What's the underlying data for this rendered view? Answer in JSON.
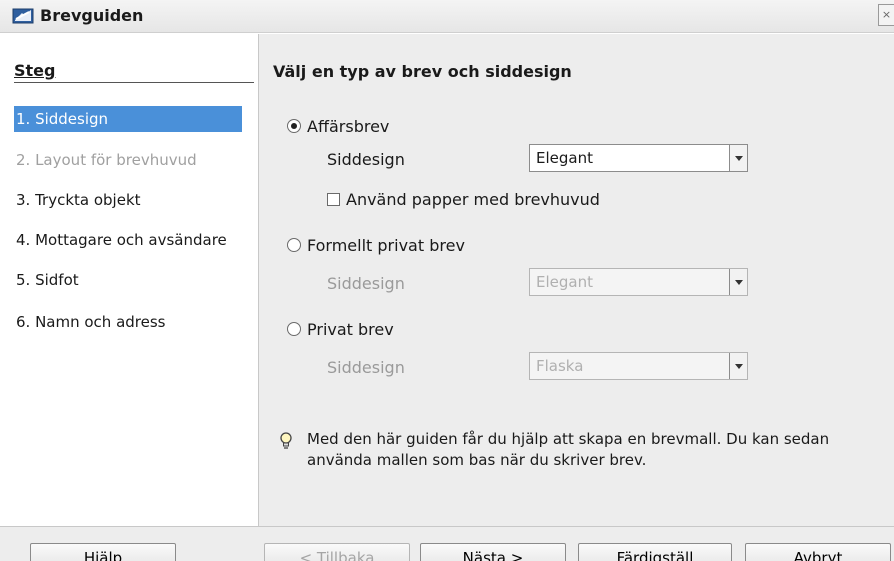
{
  "window": {
    "title": "Brevguiden",
    "app_icon": "wizard-icon",
    "close_icon": "close-icon"
  },
  "sidebar": {
    "heading": "Steg",
    "steps": [
      {
        "label": "1. Siddesign",
        "state": "active"
      },
      {
        "label": "2. Layout för brevhuvud",
        "state": "disabled"
      },
      {
        "label": "3. Tryckta objekt",
        "state": "normal"
      },
      {
        "label": "4. Mottagare och avsändare",
        "state": "normal"
      },
      {
        "label": "5. Sidfot",
        "state": "normal"
      },
      {
        "label": "6. Namn och adress",
        "state": "normal"
      }
    ]
  },
  "main": {
    "heading": "Välj en typ av brev och siddesign",
    "options": [
      {
        "label": "Affärsbrev",
        "checked": true,
        "design_label": "Siddesign",
        "design_value": "Elegant",
        "enabled": true
      },
      {
        "label": "Formellt privat brev",
        "checked": false,
        "design_label": "Siddesign",
        "design_value": "Elegant",
        "enabled": false
      },
      {
        "label": "Privat brev",
        "checked": false,
        "design_label": "Siddesign",
        "design_value": "Flaska",
        "enabled": false
      }
    ],
    "letterhead_checkbox": {
      "label": "Använd papper med brevhuvud",
      "checked": false
    },
    "info_icon": "lightbulb-icon",
    "info_text": "Med den här guiden får du hjälp att skapa en brevmall. Du kan sedan använda mallen som bas när du skriver brev."
  },
  "footer": {
    "help": "Hjälp",
    "back": "< Tillbaka",
    "next": "Nästa >",
    "finish": "Färdigställ",
    "cancel": "Avbryt"
  },
  "colors": {
    "selection": "#4a90d9",
    "panel": "#ededed",
    "disabled_text": "#a0a0a0"
  }
}
